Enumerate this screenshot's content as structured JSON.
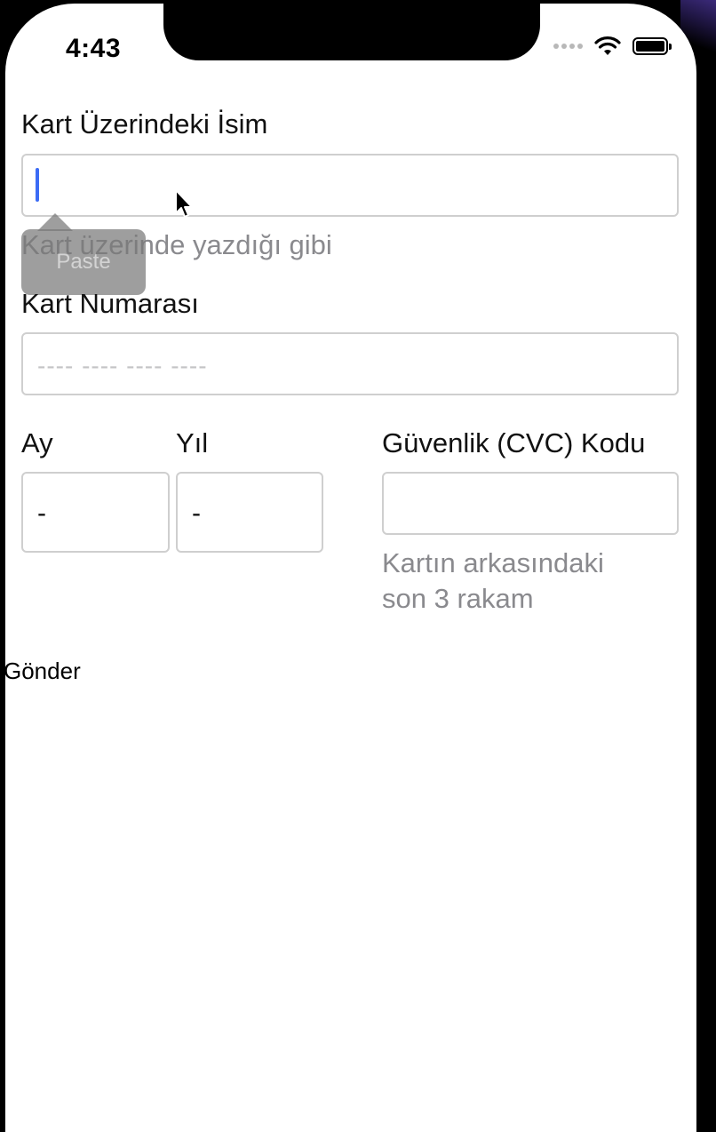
{
  "status_bar": {
    "time": "4:43"
  },
  "form": {
    "name_on_card": {
      "label": "Kart Üzerindeki İsim",
      "value": "",
      "hint": "Kart üzerinde yazdığı gibi"
    },
    "context_menu": {
      "paste_label": "Paste"
    },
    "card_number": {
      "label": "Kart Numarası",
      "placeholder": "---- ---- ---- ----"
    },
    "expiry_month": {
      "label": "Ay",
      "value": "-"
    },
    "expiry_year": {
      "label": "Yıl",
      "value": "-"
    },
    "cvc": {
      "label": "Güvenlik (CVC) Kodu",
      "value": "",
      "hint_line1": "Kartın arkasındaki",
      "hint_line2": "son 3 rakam"
    },
    "submit_label": "Gönder"
  },
  "icons": {
    "wifi": "wifi-icon",
    "battery": "battery-icon",
    "signal": "cellular-signal-icon",
    "cursor": "mouse-pointer-icon"
  },
  "colors": {
    "caret": "#3b6bf5",
    "hint": "#8a8a8e",
    "field_border": "#cfcfcf"
  }
}
